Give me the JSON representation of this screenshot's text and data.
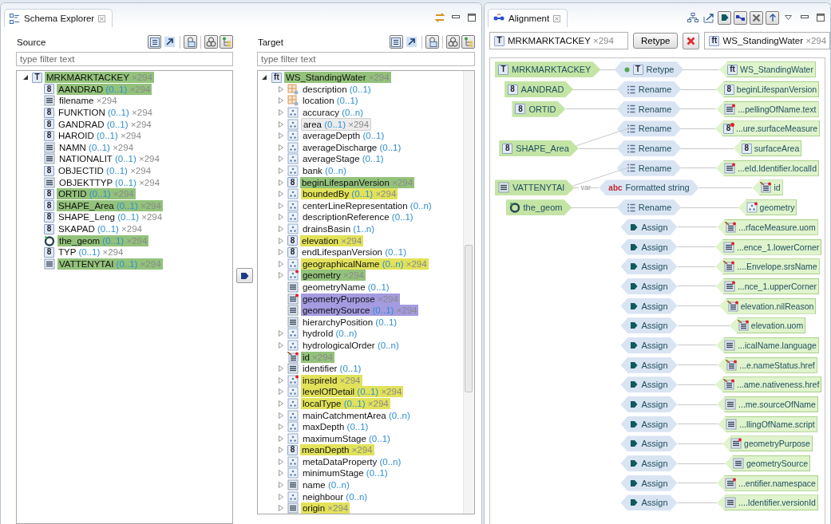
{
  "schema_explorer": {
    "title": "Schema Explorer",
    "source": {
      "label": "Source",
      "filter_placeholder": "type filter text",
      "root": {
        "glyph": "T",
        "name": "MRKMARKTACKEY",
        "count": "×294",
        "color": "#93c27b",
        "selected": false,
        "expanded": true,
        "children": [
          {
            "glyph": "8",
            "name": "AANDRAD",
            "card": "(0..1)",
            "count": "×294",
            "color": "#93c27b",
            "selected": false
          },
          {
            "kind": "string",
            "name": "filename",
            "count": "×294",
            "selected": false
          },
          {
            "glyph": "8",
            "name": "FUNKTION",
            "card": "(0..1)",
            "count": "×294",
            "selected": false
          },
          {
            "glyph": "8",
            "name": "GANDRAD",
            "card": "(0..1)",
            "count": "×294",
            "selected": false
          },
          {
            "glyph": "8",
            "name": "HAROID",
            "card": "(0..1)",
            "count": "×294",
            "selected": false
          },
          {
            "kind": "string",
            "name": "NAMN",
            "card": "(0..1)",
            "count": "×294",
            "selected": false
          },
          {
            "kind": "string",
            "name": "NATIONALIT",
            "card": "(0..1)",
            "count": "×294",
            "selected": false
          },
          {
            "glyph": "8",
            "name": "OBJECTID",
            "card": "(0..1)",
            "count": "×294",
            "selected": false
          },
          {
            "kind": "string",
            "name": "OBJEKTTYP",
            "card": "(0..1)",
            "count": "×294",
            "selected": false
          },
          {
            "glyph": "8",
            "name": "ORTID",
            "card": "(0..1)",
            "count": "×294",
            "color": "#93c27b",
            "selected": false
          },
          {
            "glyph": "8",
            "name": "SHAPE_Area",
            "card": "(0..1)",
            "count": "×294",
            "color": "#93c27b",
            "selected": false
          },
          {
            "glyph": "8",
            "name": "SHAPE_Leng",
            "card": "(0..1)",
            "count": "×294",
            "selected": false
          },
          {
            "glyph": "8",
            "name": "SKAPAD",
            "card": "(0..1)",
            "count": "×294",
            "selected": false
          },
          {
            "kind": "geometry",
            "name": "the_geom",
            "card": "(0..1)",
            "count": "×294",
            "color": "#93c27b",
            "selected": false
          },
          {
            "glyph": "8",
            "name": "TYP",
            "card": "(0..1)",
            "count": "×294",
            "selected": false
          },
          {
            "kind": "string",
            "name": "VATTENYTAI",
            "card": "(0..1)",
            "count": "×294",
            "color": "#93c27b",
            "selected": false
          }
        ]
      }
    },
    "target": {
      "label": "Target",
      "filter_placeholder": "type filter text",
      "root": {
        "glyph": "ft",
        "name": "WS_StandingWater",
        "count": "×294",
        "color": "#93c27b",
        "selected": false,
        "expanded": true,
        "children": [
          {
            "kind": "group",
            "expandable": true,
            "name": "description",
            "card": "(0..1)",
            "selected": false
          },
          {
            "kind": "group",
            "expandable": true,
            "name": "location",
            "card": "(0..1)",
            "selected": false
          },
          {
            "kind": "complex",
            "expandable": true,
            "name": "accuracy",
            "card": "(0..n)",
            "selected": false
          },
          {
            "kind": "complex",
            "expandable": true,
            "name": "area",
            "card": "(0..1)",
            "count": "×294",
            "selected": true
          },
          {
            "kind": "complex",
            "expandable": true,
            "name": "averageDepth",
            "card": "(0..1)",
            "selected": false
          },
          {
            "kind": "complex",
            "expandable": true,
            "name": "averageDischarge",
            "card": "(0..1)",
            "selected": false
          },
          {
            "kind": "complex",
            "expandable": true,
            "name": "averageStage",
            "card": "(0..1)",
            "selected": false
          },
          {
            "kind": "complex",
            "expandable": true,
            "name": "bank",
            "card": "(0..n)",
            "selected": false
          },
          {
            "glyph": "8",
            "expandable": true,
            "name": "beginLifespanVersion",
            "count": "×294",
            "color": "#93c27b",
            "selected": false
          },
          {
            "kind": "complex",
            "expandable": true,
            "name": "boundedBy",
            "card": "(0..1)",
            "count": "×294",
            "color": "#e2e25a",
            "selected": false
          },
          {
            "kind": "complex",
            "expandable": true,
            "name": "centerLineRepresentation",
            "card": "(0..n)",
            "selected": false
          },
          {
            "kind": "complex",
            "expandable": true,
            "name": "descriptionReference",
            "card": "(0..1)",
            "selected": false
          },
          {
            "kind": "complex",
            "expandable": true,
            "name": "drainsBasin",
            "card": "(1..n)",
            "selected": false
          },
          {
            "glyph": "8",
            "expandable": true,
            "name": "elevation",
            "count": "×294",
            "color": "#e2e25a",
            "selected": false
          },
          {
            "glyph": "8",
            "expandable": true,
            "name": "endLifespanVersion",
            "card": "(0..1)",
            "selected": false
          },
          {
            "kind": "complex",
            "expandable": true,
            "name": "geographicalName",
            "card": "(0..n)",
            "count": "×294",
            "color": "#e2e25a",
            "selected": false
          },
          {
            "kind": "complex",
            "required": true,
            "expandable": true,
            "name": "geometry",
            "count": "×294",
            "color": "#93c27b",
            "selected": false
          },
          {
            "kind": "string",
            "expandable": false,
            "name": "geometryName",
            "card": "(0..1)",
            "selected": false
          },
          {
            "kind": "string",
            "required": true,
            "expandable": false,
            "name": "geometryPurpose",
            "count": "×294",
            "color": "#a49be0",
            "selected": false
          },
          {
            "kind": "string",
            "expandable": false,
            "name": "geometrySource",
            "card": "(0..1)",
            "count": "×294",
            "color": "#a49be0",
            "selected": false
          },
          {
            "kind": "string",
            "expandable": false,
            "name": "hierarchyPosition",
            "card": "(0..1)",
            "selected": false
          },
          {
            "kind": "complex",
            "expandable": true,
            "name": "hydroId",
            "card": "(0..n)",
            "selected": false
          },
          {
            "kind": "complex",
            "expandable": true,
            "name": "hydrologicalOrder",
            "card": "(0..n)",
            "selected": false
          },
          {
            "kind": "id",
            "expandable": false,
            "name": "id",
            "count": "×294",
            "color": "#93c27b",
            "selected": false
          },
          {
            "kind": "string",
            "expandable": true,
            "name": "identifier",
            "card": "(0..1)",
            "selected": false
          },
          {
            "kind": "complex",
            "required": true,
            "expandable": true,
            "name": "inspireId",
            "count": "×294",
            "color": "#e2e25a",
            "selected": false
          },
          {
            "kind": "complex",
            "expandable": true,
            "name": "levelOfDetail",
            "card": "(0..1)",
            "count": "×294",
            "color": "#e2e25a",
            "selected": false
          },
          {
            "kind": "complex",
            "expandable": true,
            "name": "localType",
            "card": "(0..1)",
            "count": "×294",
            "color": "#e2e25a",
            "selected": false
          },
          {
            "kind": "complex",
            "expandable": true,
            "name": "mainCatchmentArea",
            "card": "(0..n)",
            "selected": false
          },
          {
            "kind": "complex",
            "expandable": true,
            "name": "maxDepth",
            "card": "(0..1)",
            "selected": false
          },
          {
            "kind": "complex",
            "expandable": true,
            "name": "maximumStage",
            "card": "(0..1)",
            "selected": false
          },
          {
            "glyph": "8",
            "expandable": true,
            "name": "meanDepth",
            "count": "×294",
            "color": "#e2e25a",
            "selected": false
          },
          {
            "kind": "complex",
            "expandable": true,
            "name": "metaDataProperty",
            "card": "(0..n)",
            "selected": false
          },
          {
            "kind": "complex",
            "expandable": true,
            "name": "minimumStage",
            "card": "(0..1)",
            "selected": false
          },
          {
            "kind": "string",
            "expandable": true,
            "name": "name",
            "card": "(0..n)",
            "selected": false
          },
          {
            "kind": "complex",
            "expandable": true,
            "name": "neighbour",
            "card": "(0..n)",
            "selected": false
          },
          {
            "kind": "string",
            "expandable": true,
            "name": "origin",
            "count": "×294",
            "color": "#e2e25a",
            "selected": false
          }
        ]
      }
    }
  },
  "alignment": {
    "title": "Alignment",
    "editor": {
      "source": {
        "glyph": "T",
        "name": "MRKMARKTACKEY",
        "count": "×294"
      },
      "function_button": "Retype",
      "target": {
        "glyph": "ft",
        "name": "WS_StandingWater",
        "count": "×294"
      }
    },
    "cells": [
      {
        "source": {
          "glyph": "T",
          "name": "MRKMARKTACKEY"
        },
        "function": {
          "kind": "retype",
          "glyph": "T",
          "name": "Retype"
        },
        "target": {
          "glyph": "ft",
          "name": "WS_StandingWater"
        }
      },
      {
        "source": {
          "glyph": "8",
          "name": "AANDRAD"
        },
        "function": {
          "kind": "rename",
          "name": "Rename"
        },
        "target": {
          "glyph": "8",
          "name": "beginLifespanVersion"
        }
      },
      {
        "source": {
          "glyph": "8",
          "name": "ORTID"
        },
        "function": {
          "kind": "rename",
          "name": "Rename"
        },
        "target": {
          "kind": "string",
          "required": true,
          "name": "...pellingOfName.text"
        }
      },
      {
        "function": {
          "kind": "rename",
          "name": "Rename"
        },
        "extra_input_below": true,
        "target": {
          "glyph": "8",
          "required": true,
          "name": "...ure.surfaceMeasure"
        }
      },
      {
        "source": {
          "glyph": "8",
          "name": "SHAPE_Area"
        },
        "function": {
          "kind": "rename",
          "name": "Rename"
        },
        "target": {
          "glyph": "8",
          "name": "surfaceArea"
        }
      },
      {
        "function": {
          "kind": "rename",
          "name": "Rename"
        },
        "extra_input_below": true,
        "target": {
          "kind": "string",
          "required": true,
          "name": "...eId.Identifier.localId"
        }
      },
      {
        "source": {
          "kind": "string",
          "name": "VATTENYTAI"
        },
        "link_label": "var",
        "function": {
          "kind": "formatted",
          "glyph": "abc",
          "name": "Formatted string"
        },
        "target": {
          "kind": "id",
          "name": "id"
        }
      },
      {
        "source": {
          "kind": "geometry",
          "name": "the_geom"
        },
        "function": {
          "kind": "rename",
          "name": "Rename"
        },
        "target": {
          "kind": "complex",
          "required": true,
          "name": "geometry"
        }
      },
      {
        "function": {
          "kind": "assign",
          "name": "Assign"
        },
        "target": {
          "kind": "id",
          "name": "...rfaceMeasure.uom"
        }
      },
      {
        "function": {
          "kind": "assign",
          "name": "Assign"
        },
        "target": {
          "kind": "string",
          "required": true,
          "name": "...ence_1.lowerCorner"
        }
      },
      {
        "function": {
          "kind": "assign",
          "name": "Assign"
        },
        "target": {
          "kind": "id",
          "name": "....Envelope.srsName"
        }
      },
      {
        "function": {
          "kind": "assign",
          "name": "Assign"
        },
        "target": {
          "kind": "string",
          "required": true,
          "name": "...nce_1.upperCorner"
        }
      },
      {
        "function": {
          "kind": "assign",
          "name": "Assign"
        },
        "target": {
          "kind": "id",
          "name": "elevation.nilReason"
        }
      },
      {
        "function": {
          "kind": "assign",
          "name": "Assign"
        },
        "target": {
          "kind": "id",
          "name": "elevation.uom"
        }
      },
      {
        "function": {
          "kind": "assign",
          "name": "Assign"
        },
        "target": {
          "kind": "string",
          "name": "...icalName.language"
        }
      },
      {
        "function": {
          "kind": "assign",
          "name": "Assign"
        },
        "target": {
          "kind": "id",
          "name": "...e.nameStatus.href"
        }
      },
      {
        "function": {
          "kind": "assign",
          "name": "Assign"
        },
        "target": {
          "kind": "id",
          "name": "...ame.nativeness.href"
        }
      },
      {
        "function": {
          "kind": "assign",
          "name": "Assign"
        },
        "target": {
          "kind": "string",
          "name": "...me.sourceOfName"
        }
      },
      {
        "function": {
          "kind": "assign",
          "name": "Assign"
        },
        "target": {
          "kind": "string",
          "name": "...llingOfName.script"
        }
      },
      {
        "function": {
          "kind": "assign",
          "name": "Assign"
        },
        "target": {
          "kind": "string",
          "required": true,
          "name": "geometryPurpose"
        }
      },
      {
        "function": {
          "kind": "assign",
          "name": "Assign"
        },
        "target": {
          "kind": "string",
          "name": "geometrySource"
        }
      },
      {
        "function": {
          "kind": "assign",
          "name": "Assign"
        },
        "target": {
          "kind": "string",
          "required": true,
          "name": "...entifier.namespace"
        }
      },
      {
        "function": {
          "kind": "assign",
          "name": "Assign"
        },
        "target": {
          "kind": "string",
          "name": "....Identifier.versionId"
        }
      }
    ]
  }
}
